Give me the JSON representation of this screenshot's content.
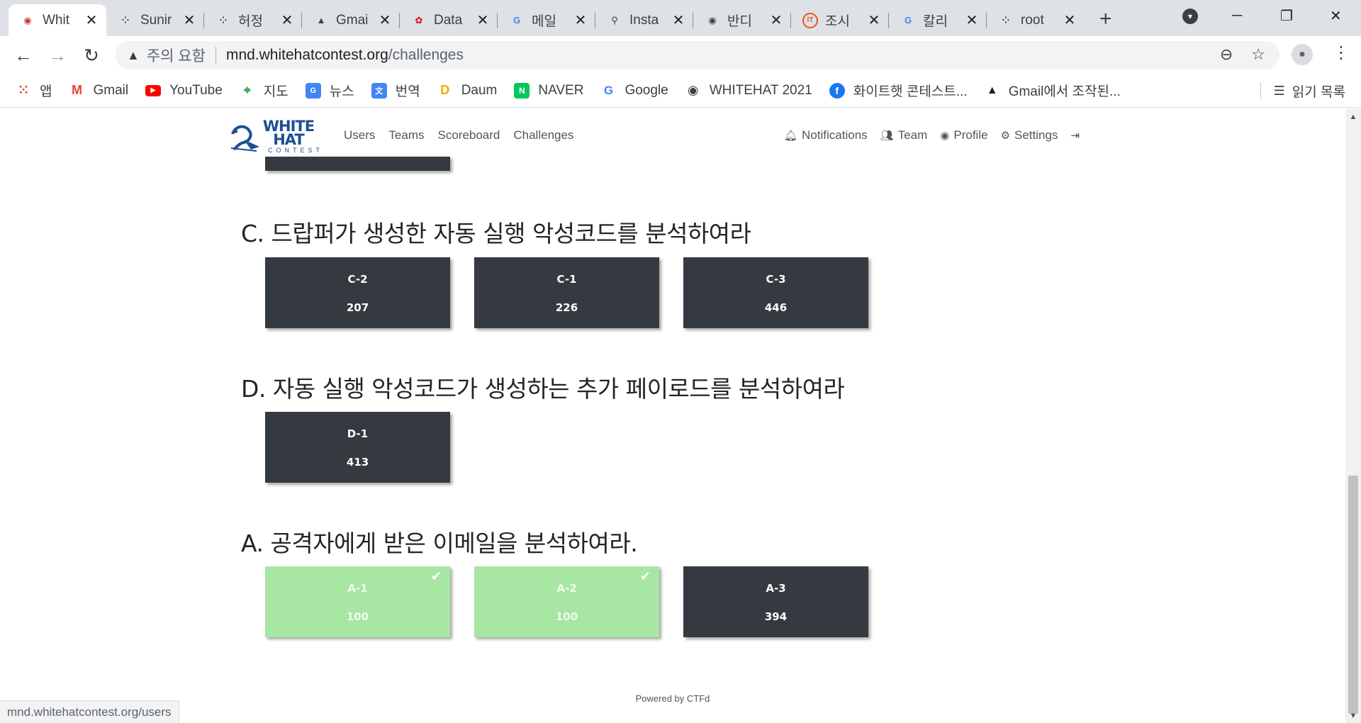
{
  "browser": {
    "tabs": [
      {
        "title": "Whit",
        "icon": "ctfd-icon",
        "active": true
      },
      {
        "title": "Sunir",
        "icon": "dots-icon"
      },
      {
        "title": "허정",
        "icon": "dots-icon"
      },
      {
        "title": "Gmai",
        "icon": "mountain-icon"
      },
      {
        "title": "Data",
        "icon": "huawei-icon"
      },
      {
        "title": "메일",
        "icon": "google-icon"
      },
      {
        "title": "Insta",
        "icon": "kali-icon"
      },
      {
        "title": "반디",
        "icon": "globe-icon"
      },
      {
        "title": "조시",
        "icon": "it-icon"
      },
      {
        "title": "칼리",
        "icon": "google-icon"
      },
      {
        "title": "root",
        "icon": "dots-icon"
      }
    ],
    "omnibox": {
      "security_label": "주의 요함",
      "host": "mnd.whitehatcontest.org",
      "path": "/challenges"
    },
    "bookmarks": [
      {
        "label": "앱",
        "color": "#ea4335"
      },
      {
        "label": "Gmail",
        "color": "#ea4335"
      },
      {
        "label": "YouTube",
        "color": "#ff0000"
      },
      {
        "label": "지도",
        "color": "#34a853"
      },
      {
        "label": "뉴스",
        "color": "#4285f4"
      },
      {
        "label": "번역",
        "color": "#4285f4"
      },
      {
        "label": "Daum",
        "color": "#fbbc05"
      },
      {
        "label": "NAVER",
        "color": "#03c75a"
      },
      {
        "label": "Google",
        "color": "#4285f4"
      },
      {
        "label": "WHITEHAT 2021",
        "color": "#3c4043"
      },
      {
        "label": "화이트햇 콘테스트...",
        "color": "#1877f2"
      },
      {
        "label": "Gmail에서 조작된...",
        "color": "#202124"
      }
    ],
    "reading_list": "읽기 목록",
    "status_url": "mnd.whitehatcontest.org/users"
  },
  "site": {
    "nav_left": [
      "Users",
      "Teams",
      "Scoreboard",
      "Challenges"
    ],
    "nav_right": [
      {
        "label": "Notifications",
        "icon": "bell-icon"
      },
      {
        "label": "Team",
        "icon": "users-icon"
      },
      {
        "label": "Profile",
        "icon": "user-circle-icon"
      },
      {
        "label": "Settings",
        "icon": "gears-icon"
      }
    ],
    "logo": {
      "line1": "WHITE",
      "line2": "HAT",
      "line3": "CONTEST"
    }
  },
  "categories": [
    {
      "title": "C. 드랍퍼가 생성한 자동 실행 악성코드를 분석하여라",
      "challenges": [
        {
          "name": "C-2",
          "points": "207",
          "solved": false
        },
        {
          "name": "C-1",
          "points": "226",
          "solved": false
        },
        {
          "name": "C-3",
          "points": "446",
          "solved": false
        }
      ]
    },
    {
      "title": "D. 자동 실행 악성코드가 생성하는 추가 페이로드를 분석하여라",
      "challenges": [
        {
          "name": "D-1",
          "points": "413",
          "solved": false
        }
      ]
    },
    {
      "title": "A. 공격자에게 받은 이메일을 분석하여라.",
      "challenges": [
        {
          "name": "A-1",
          "points": "100",
          "solved": true
        },
        {
          "name": "A-2",
          "points": "100",
          "solved": true
        },
        {
          "name": "A-3",
          "points": "394",
          "solved": false
        }
      ]
    }
  ],
  "footer": "Powered by CTFd"
}
